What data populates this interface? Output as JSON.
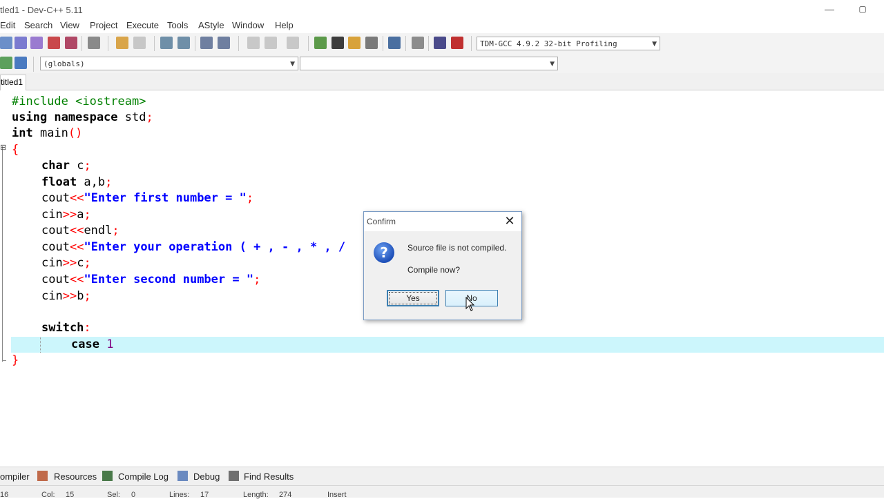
{
  "window": {
    "title": "tled1 - Dev-C++ 5.11",
    "min_glyph": "—",
    "restore_glyph": "▢"
  },
  "menu": [
    "Edit",
    "Search",
    "View",
    "Project",
    "Execute",
    "Tools",
    "AStyle",
    "Window",
    "Help"
  ],
  "toolbar": {
    "compiler_select": "TDM-GCC 4.9.2 32-bit Profiling",
    "scope_select": "(globals)",
    "member_select": ""
  },
  "tabs": {
    "file_tab": "titled1"
  },
  "code": {
    "line1": "#include <iostream>",
    "line2_kw": "using namespace",
    "line2_rest": " std",
    "line2_semi": ";",
    "line3_kw": "int",
    "line3_rest": " main",
    "line3_paren": "()",
    "line4": "{",
    "line5_kw": "char",
    "line5_rest": " c",
    "line5_semi": ";",
    "line6_kw": "float",
    "line6_rest": " a,b",
    "line6_semi": ";",
    "line7_a": "cout",
    "line7_op": "<<",
    "line7_str": "\"Enter first number = \"",
    "line7_semi": ";",
    "line8_a": "cin",
    "line8_op": ">>",
    "line8_b": "a",
    "line8_semi": ";",
    "line9_a": "cout",
    "line9_op": "<<",
    "line9_b": "endl",
    "line9_semi": ";",
    "line10_a": "cout",
    "line10_op": "<<",
    "line10_str": "\"Enter your operation ( + , - , * , /",
    "line11_a": "cin",
    "line11_op": ">>",
    "line11_b": "c",
    "line11_semi": ";",
    "line12_a": "cout",
    "line12_op": "<<",
    "line12_str": "\"Enter second number = \"",
    "line12_semi": ";",
    "line13_a": "cin",
    "line13_op": ">>",
    "line13_b": "b",
    "line13_semi": ";",
    "line14_kw": "switch",
    "line14_colon": ":",
    "line15_kw": "case",
    "line15_num": "1",
    "line16": "}",
    "fold_glyph": "⊟"
  },
  "bottom_tabs": [
    "ompiler",
    "Resources",
    "Compile Log",
    "Debug",
    "Find Results"
  ],
  "status": {
    "line_val": "16",
    "col": "Col:",
    "col_val": "15",
    "sel": "Sel:",
    "sel_val": "0",
    "lines": "Lines:",
    "lines_val": "17",
    "length": "Length:",
    "length_val": "274",
    "mode": "Insert"
  },
  "dialog": {
    "title": "Confirm",
    "close_glyph": "✕",
    "icon_glyph": "?",
    "message1": "Source file is not compiled.",
    "message2": "Compile now?",
    "yes_label": "Yes",
    "no_label": "No"
  },
  "colors": {
    "current_line": "#ccf6fc",
    "keyword": "#000000",
    "preprocessor": "#008000",
    "string": "#0000ff",
    "operator": "#ff0000",
    "number": "#800080"
  }
}
